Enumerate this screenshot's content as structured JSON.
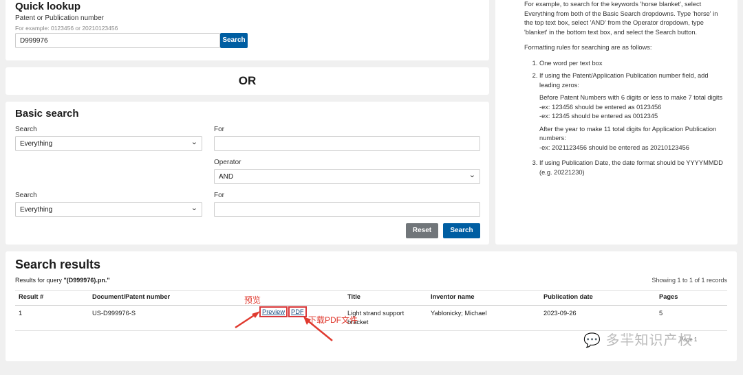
{
  "quick": {
    "title": "Quick lookup",
    "label": "Patent or Publication number",
    "hint": "For example: 0123456 or 20210123456",
    "value": "D999976",
    "search": "Search"
  },
  "or": "OR",
  "basic": {
    "title": "Basic search",
    "search1_label": "Search",
    "search1_value": "Everything",
    "for1_label": "For",
    "operator_label": "Operator",
    "operator_value": "AND",
    "search2_label": "Search",
    "search2_value": "Everything",
    "for2_label": "For",
    "reset": "Reset",
    "search": "Search"
  },
  "help": {
    "intro": "For example, to search for the keywords 'horse blanket', select Everything from both of the Basic Search dropdowns. Type 'horse' in the top text box, select 'AND' from the Operator dropdown, type 'blanket' in the bottom text box, and select the Search button.",
    "rules_title": "Formatting rules for searching are as follows:",
    "r1": "One word per text box",
    "r2": "If using the Patent/Application Publication number field, add leading zeros:",
    "r2a": "Before Patent Numbers with 6 digits or less to make 7 total digits",
    "r2b": "-ex: 123456 should be entered as 0123456",
    "r2c": "-ex: 12345 should be entered as 0012345",
    "r2d": "After the year to make 11 total digits for Application Publication numbers:",
    "r2e": "-ex: 2021123456 should be entered as 20210123456",
    "r3": "If using Publication Date, the date format should be YYYYMMDD (e.g. 20221230)"
  },
  "results": {
    "title": "Search results",
    "query_prefix": "Results for query ",
    "query": "\"(D999976).pn.\"",
    "showing": "Showing 1 to 1 of 1 records",
    "headers": [
      "Result #",
      "Document/Patent number",
      "Title",
      "Inventor name",
      "Publication date",
      "Pages"
    ],
    "row": {
      "num": "1",
      "doc": "US-D999976-S",
      "preview": "Preview",
      "pdf": "PDF",
      "title": "Light strand support bracket",
      "inventor": "Yablonicky; Michael",
      "date": "2023-09-26",
      "pages": "5"
    },
    "pagination": "Page 1"
  },
  "annot": {
    "preview": "预览",
    "pdf": "下载PDF文件"
  },
  "watermark": "多羋知识产权",
  "colors": {
    "primary": "#005ea2",
    "reset": "#71767a",
    "annot": "#e03a2f"
  }
}
